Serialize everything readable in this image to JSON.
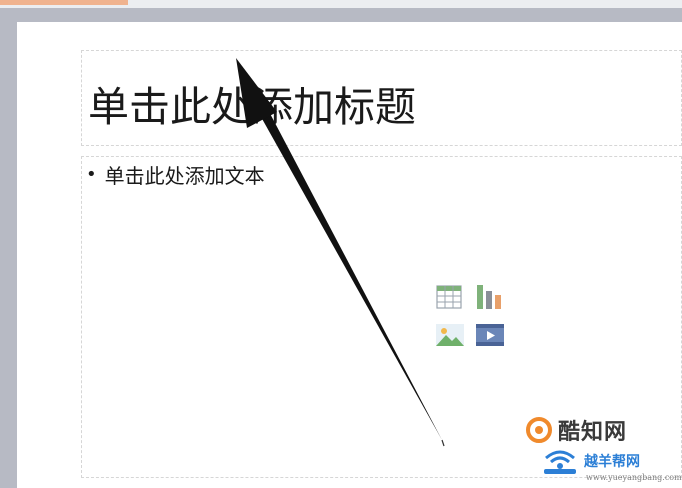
{
  "slide": {
    "title_placeholder": "单击此处添加标题",
    "body_placeholder": "单击此处添加文本",
    "bullet": "•"
  },
  "insert_icons": {
    "table": "table-icon",
    "chart": "chart-icon",
    "picture": "picture-icon",
    "media": "media-icon"
  },
  "watermark": {
    "brand_text": "酷知网",
    "secondary_text": "越羊帮网",
    "url": "www.yueyangbang.com"
  },
  "colors": {
    "workspace": "#b7bac4",
    "slide": "#ffffff",
    "placeholder_border": "#d6d6d6",
    "title_text": "#1a1a1a",
    "arrow": "#111111",
    "watermark_orange": "#f08a2c",
    "watermark_blue": "#2c7fd6"
  }
}
